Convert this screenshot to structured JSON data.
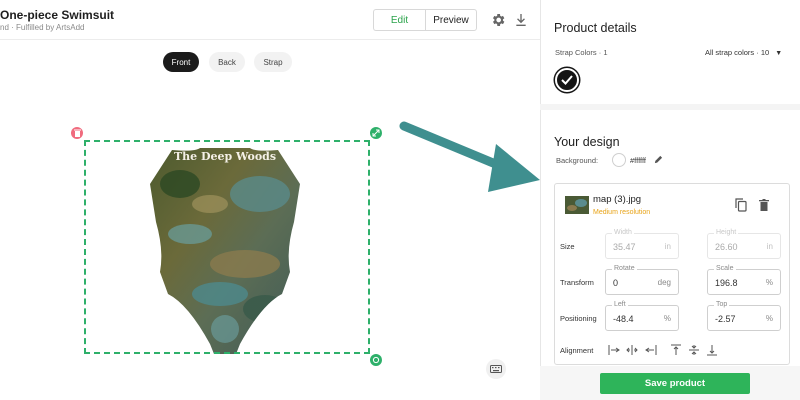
{
  "header": {
    "product_title": "One-piece Swimsuit",
    "product_subtitle": "nd · Fulfilled by ArtsAdd",
    "edit_label": "Edit",
    "preview_label": "Preview"
  },
  "view_tabs": [
    "Front",
    "Back",
    "Strap"
  ],
  "design": {
    "overlay_text": "The Deep Woods"
  },
  "panel": {
    "product_details_title": "Product details",
    "strap_colors_label": "Strap Colors · 1",
    "all_strap_colors_label": "All strap colors · 10",
    "your_design_title": "Your design",
    "background_label": "Background:",
    "background_value": "#ffffff",
    "layer": {
      "filename": "map (3).jpg",
      "resolution_note": "Medium resolution"
    },
    "size_label": "Size",
    "transform_label": "Transform",
    "positioning_label": "Positioning",
    "alignment_label": "Alignment",
    "fields": {
      "width": {
        "label": "Width",
        "value": "35.47",
        "unit": "in"
      },
      "height": {
        "label": "Height",
        "value": "26.60",
        "unit": "in"
      },
      "rotate": {
        "label": "Rotate",
        "value": "0",
        "unit": "deg"
      },
      "scale": {
        "label": "Scale",
        "value": "196.8",
        "unit": "%"
      },
      "left": {
        "label": "Left",
        "value": "-48.4",
        "unit": "%"
      },
      "top": {
        "label": "Top",
        "value": "-2.57",
        "unit": "%"
      }
    },
    "save_label": "Save product"
  },
  "colors": {
    "accent_green": "#2eb45a",
    "resolution_warning": "#e8a317",
    "arrow_teal": "#3f8f8f",
    "delete_pink": "#f06b7e"
  }
}
